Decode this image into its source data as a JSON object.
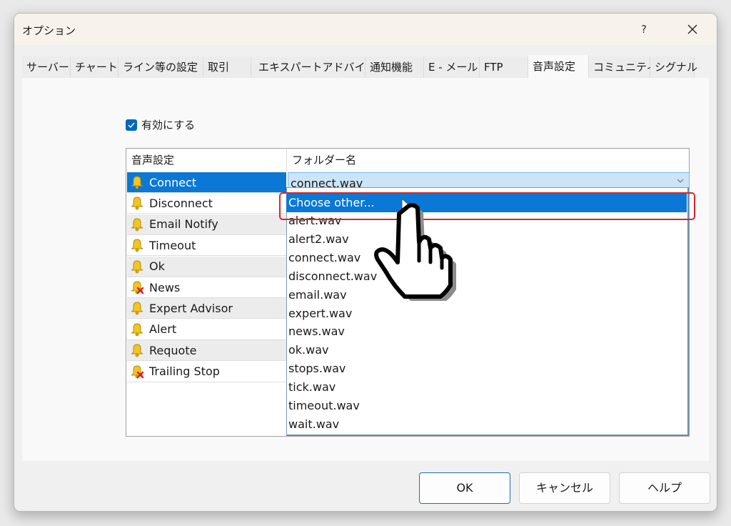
{
  "window": {
    "title": "オプション",
    "help_label": "?",
    "close_icon": "close-icon"
  },
  "tabs": [
    {
      "label": "サーバー",
      "active": false
    },
    {
      "label": "チャート",
      "active": false
    },
    {
      "label": "ライン等の設定",
      "active": false
    },
    {
      "label": "取引",
      "active": false
    },
    {
      "label": "エキスパートアドバイザ",
      "active": false
    },
    {
      "label": "通知機能",
      "active": false
    },
    {
      "label": "E - メール",
      "active": false
    },
    {
      "label": "FTP",
      "active": false
    },
    {
      "label": "音声設定",
      "active": true
    },
    {
      "label": "コミュニティ",
      "active": false
    },
    {
      "label": "シグナル",
      "active": false
    }
  ],
  "enable": {
    "label": "有効にする",
    "checked": true
  },
  "table": {
    "headers": [
      "音声設定",
      "フォルダー名"
    ],
    "rows": [
      {
        "event": "Connect",
        "icon": "bell-icon",
        "disabled": false,
        "selected": true
      },
      {
        "event": "Disconnect",
        "icon": "bell-icon",
        "disabled": false,
        "selected": false
      },
      {
        "event": "Email Notify",
        "icon": "bell-icon",
        "disabled": false,
        "selected": false
      },
      {
        "event": "Timeout",
        "icon": "bell-icon",
        "disabled": false,
        "selected": false
      },
      {
        "event": "Ok",
        "icon": "bell-icon",
        "disabled": false,
        "selected": false
      },
      {
        "event": "News",
        "icon": "bell-disabled-icon",
        "disabled": true,
        "selected": false
      },
      {
        "event": "Expert Advisor",
        "icon": "bell-icon",
        "disabled": false,
        "selected": false
      },
      {
        "event": "Alert",
        "icon": "bell-icon",
        "disabled": false,
        "selected": false
      },
      {
        "event": "Requote",
        "icon": "bell-icon",
        "disabled": false,
        "selected": false
      },
      {
        "event": "Trailing Stop",
        "icon": "bell-disabled-icon",
        "disabled": true,
        "selected": false
      }
    ],
    "combo_value": "connect.wav"
  },
  "dropdown": {
    "options": [
      "Choose other...",
      "alert.wav",
      "alert2.wav",
      "connect.wav",
      "disconnect.wav",
      "email.wav",
      "expert.wav",
      "news.wav",
      "ok.wav",
      "stops.wav",
      "tick.wav",
      "timeout.wav",
      "wait.wav"
    ],
    "highlighted_index": 0
  },
  "annotation": {
    "highlight_color": "#d8262b",
    "cursor": "hand-pointer-icon"
  },
  "buttons": {
    "ok": "OK",
    "cancel": "キャンセル",
    "help": "ヘルプ"
  },
  "colors": {
    "selection": "#0a78d4",
    "checkbox": "#0067c0",
    "combo_bg": "#cce4f7"
  }
}
